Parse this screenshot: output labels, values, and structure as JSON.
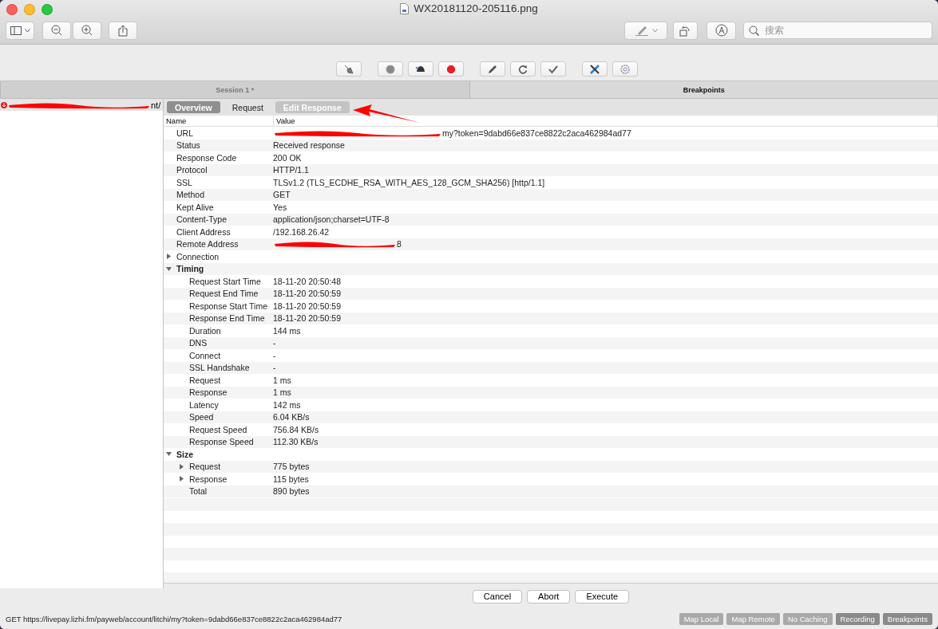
{
  "window": {
    "title": "WX20181120-205116.png"
  },
  "search": {
    "placeholder": "搜索"
  },
  "session_tabs": [
    {
      "label": "Session 1 *",
      "selected": false
    },
    {
      "label": "Breakpoints",
      "selected": true
    }
  ],
  "sidebar": {
    "items": [
      {
        "label": "nt/",
        "redacted": true
      }
    ]
  },
  "detail_tabs": [
    {
      "label": "Overview",
      "selected": true,
      "disabled": false
    },
    {
      "label": "Request",
      "selected": false,
      "disabled": false
    },
    {
      "label": "Edit Response",
      "selected": false,
      "disabled": true
    }
  ],
  "table": {
    "columns": [
      "Name",
      "Value"
    ],
    "rows": [
      {
        "name": "URL",
        "value": "my?token=9dabd66e837ce8822c2aca462984ad77",
        "redacted": true
      },
      {
        "name": "Status",
        "value": "Received response"
      },
      {
        "name": "Response Code",
        "value": "200 OK"
      },
      {
        "name": "Protocol",
        "value": "HTTP/1.1"
      },
      {
        "name": "SSL",
        "value": "TLSv1.2 (TLS_ECDHE_RSA_WITH_AES_128_GCM_SHA256) [http/1.1]"
      },
      {
        "name": "Method",
        "value": "GET"
      },
      {
        "name": "Kept Alive",
        "value": "Yes"
      },
      {
        "name": "Content-Type",
        "value": "application/json;charset=UTF-8"
      },
      {
        "name": "Client Address",
        "value": "/192.168.26.42"
      },
      {
        "name": "Remote Address",
        "value": "8",
        "redacted": true
      },
      {
        "name": "Connection",
        "expanded": false
      },
      {
        "name": "Timing",
        "expanded": true,
        "children": [
          {
            "name": "Request Start Time",
            "value": "18-11-20 20:50:48"
          },
          {
            "name": "Request End Time",
            "value": "18-11-20 20:50:59"
          },
          {
            "name": "Response Start Time",
            "value": "18-11-20 20:50:59"
          },
          {
            "name": "Response End Time",
            "value": "18-11-20 20:50:59"
          },
          {
            "name": "Duration",
            "value": "144 ms"
          },
          {
            "name": "DNS",
            "value": "-"
          },
          {
            "name": "Connect",
            "value": "-"
          },
          {
            "name": "SSL Handshake",
            "value": "-"
          },
          {
            "name": "Request",
            "value": "1 ms"
          },
          {
            "name": "Response",
            "value": "1 ms"
          },
          {
            "name": "Latency",
            "value": "142 ms"
          },
          {
            "name": "Speed",
            "value": "6.04 KB/s"
          },
          {
            "name": "Request Speed",
            "value": "756.84 KB/s"
          },
          {
            "name": "Response Speed",
            "value": "112.30 KB/s"
          }
        ]
      },
      {
        "name": "Size",
        "expanded": true,
        "children": [
          {
            "name": "Request",
            "value": "775 bytes",
            "expanded": false
          },
          {
            "name": "Response",
            "value": "115 bytes",
            "expanded": false
          },
          {
            "name": "Total",
            "value": "890 bytes"
          }
        ]
      }
    ]
  },
  "buttons": [
    "Cancel",
    "Abort",
    "Execute"
  ],
  "status_bar": {
    "text": "GET https://livepay.lizhi.fm/payweb/account/litchi/my?token=9dabd66e837ce8822c2aca462984ad77",
    "toggles": [
      {
        "label": "Map Local",
        "on": false
      },
      {
        "label": "Map Remote",
        "on": false
      },
      {
        "label": "No Caching",
        "on": false
      },
      {
        "label": "Recording",
        "on": true
      },
      {
        "label": "Breakpoints",
        "on": true
      }
    ]
  }
}
